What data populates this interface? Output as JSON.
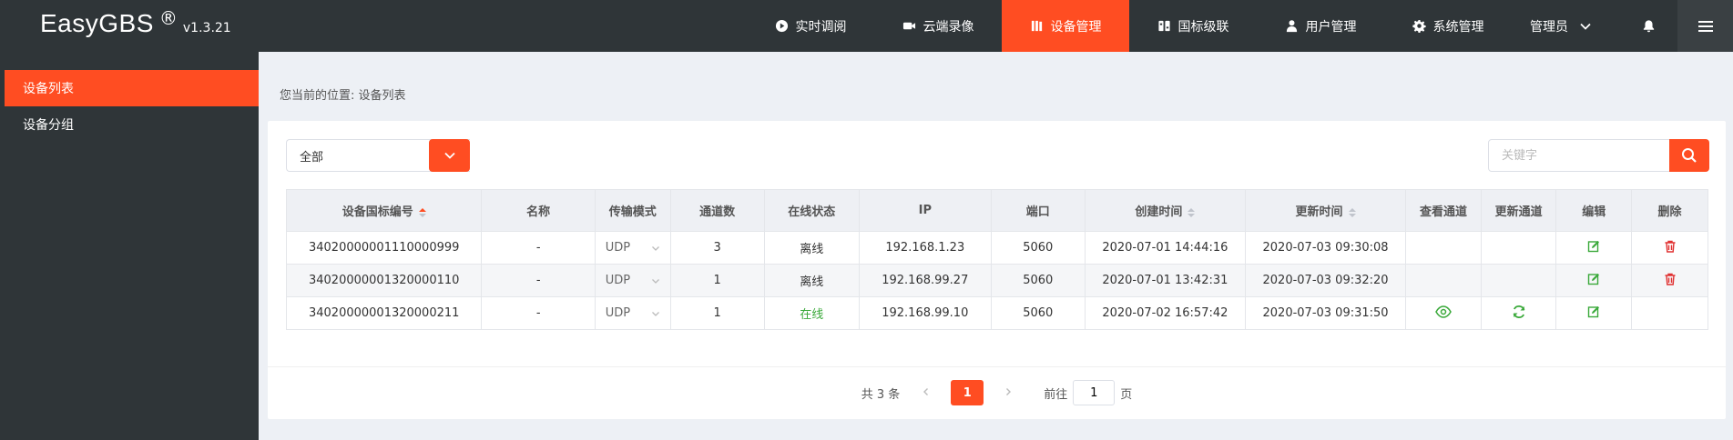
{
  "header": {
    "brand": "EasyGBS",
    "reg": "®",
    "version": "v1.3.21",
    "nav": [
      {
        "label": "实时调阅",
        "icon": "play-circle-icon"
      },
      {
        "label": "云端录像",
        "icon": "video-camera-icon"
      },
      {
        "label": "设备管理",
        "icon": "device-icon",
        "active": true
      },
      {
        "label": "国标级联",
        "icon": "cascade-icon"
      },
      {
        "label": "用户管理",
        "icon": "user-icon"
      },
      {
        "label": "系统管理",
        "icon": "gear-icon"
      }
    ],
    "user": "管理员"
  },
  "sidebar": {
    "items": [
      {
        "label": "设备列表",
        "active": true
      },
      {
        "label": "设备分组"
      }
    ]
  },
  "breadcrumb": "您当前的位置: 设备列表",
  "filter": {
    "selected": "全部",
    "search_placeholder": "关键字"
  },
  "table": {
    "headers": [
      "设备国标编号",
      "名称",
      "传输模式",
      "通道数",
      "在线状态",
      "IP",
      "端口",
      "创建时间",
      "更新时间",
      "查看通道",
      "更新通道",
      "编辑",
      "删除"
    ],
    "rows": [
      {
        "id": "34020000001110000999",
        "name": "-",
        "mode": "UDP",
        "channels": "3",
        "status": "离线",
        "ip": "192.168.1.23",
        "port": "5060",
        "created": "2020-07-01 14:44:16",
        "updated": "2020-07-03 09:30:08"
      },
      {
        "id": "34020000001320000110",
        "name": "-",
        "mode": "UDP",
        "channels": "1",
        "status": "离线",
        "ip": "192.168.99.27",
        "port": "5060",
        "created": "2020-07-01 13:42:31",
        "updated": "2020-07-03 09:32:20"
      },
      {
        "id": "34020000001320000211",
        "name": "-",
        "mode": "UDP",
        "channels": "1",
        "status": "在线",
        "ip": "192.168.99.10",
        "port": "5060",
        "created": "2020-07-02 16:57:42",
        "updated": "2020-07-03 09:31:50"
      }
    ]
  },
  "pagination": {
    "total": "共 3 条",
    "current": "1",
    "goto_prefix": "前往",
    "goto_value": "1",
    "goto_suffix": "页"
  },
  "colors": {
    "accent": "#ff4d22",
    "online": "#3aa93a",
    "header_bg": "#2f3538",
    "delete": "#e03030"
  }
}
